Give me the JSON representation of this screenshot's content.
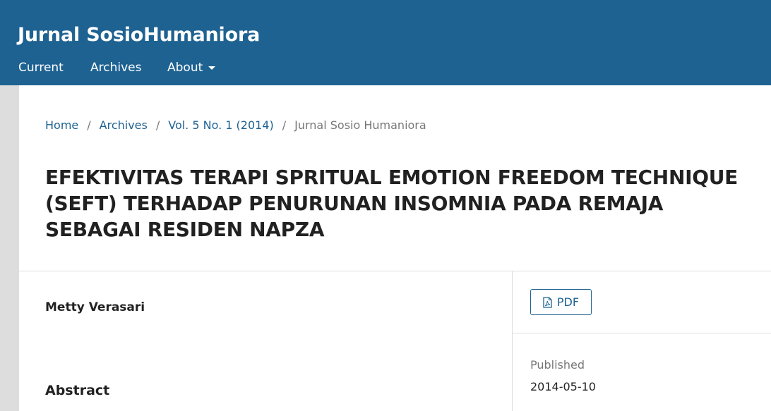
{
  "header": {
    "site_title": "Jurnal SosioHumaniora",
    "nav": {
      "current": "Current",
      "archives": "Archives",
      "about": "About"
    }
  },
  "breadcrumb": {
    "home": "Home",
    "archives": "Archives",
    "issue": "Vol. 5 No. 1 (2014)",
    "current": "Jurnal Sosio Humaniora",
    "separator": "/"
  },
  "article": {
    "title": "EFEKTIVITAS TERAPI SPRITUAL EMOTION FREEDOM TECHNIQUE (SEFT) TERHADAP PENURUNAN INSOMNIA PADA REMAJA SEBAGAI RESIDEN NAPZA",
    "author": "Metty Verasari",
    "abstract_heading": "Abstract"
  },
  "sidebar": {
    "pdf_label": "PDF",
    "published_label": "Published",
    "published_date": "2014-05-10"
  },
  "colors": {
    "brand": "#1e6292",
    "background": "#dddddd"
  },
  "icons": {
    "pdf": "file-pdf-icon",
    "about_dropdown": "caret-down-icon"
  }
}
